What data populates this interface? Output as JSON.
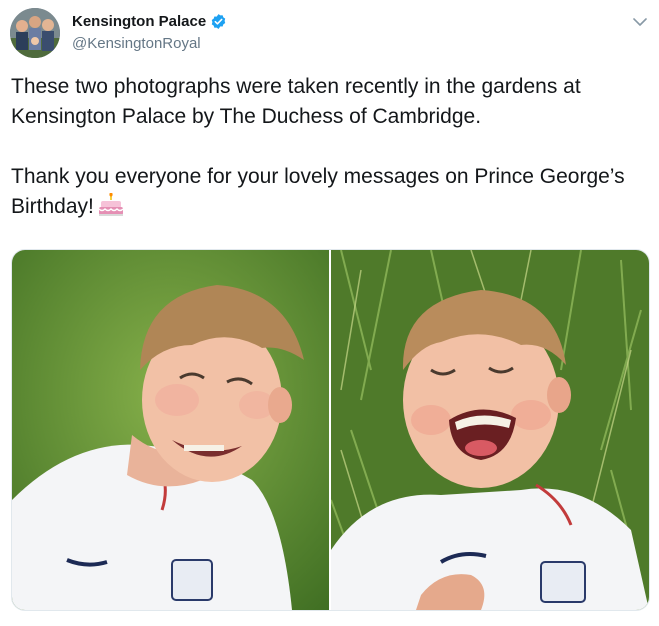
{
  "author": {
    "display_name": "Kensington Palace",
    "handle": "@KensingtonRoyal",
    "verified_icon": "verified-badge-icon",
    "avatar_icon": "family-photo-avatar"
  },
  "tweet": {
    "paragraphs": [
      "These two photographs were taken recently in the gardens at Kensington Palace by The Duchess of Cambridge.",
      "Thank you everyone for your lovely messages on Prince George’s Birthday!"
    ],
    "emoji": "birthday-cake-icon"
  },
  "media": {
    "photos": [
      {
        "icon": "photo-boy-smiling-grass"
      },
      {
        "icon": "photo-boy-laughing-lying-in-grass"
      }
    ]
  },
  "colors": {
    "verified": "#1da1f2",
    "handle": "#657786",
    "border": "#e1e8ed"
  }
}
